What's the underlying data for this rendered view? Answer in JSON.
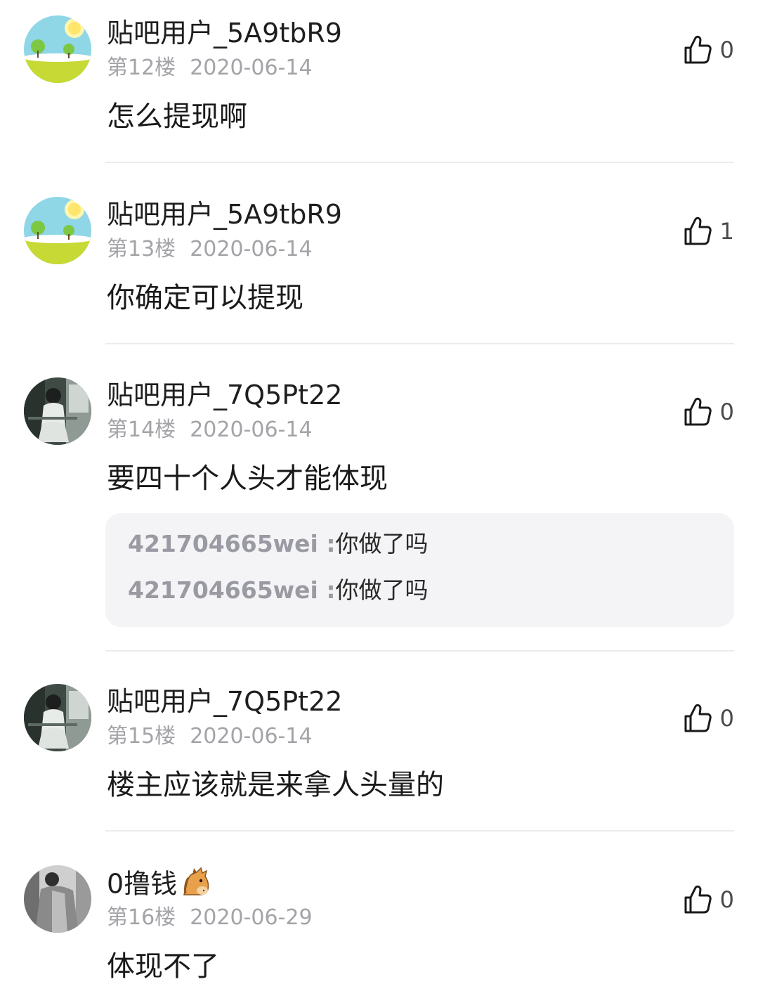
{
  "posts": [
    {
      "username": "贴吧用户_5A9tbR9",
      "floor": "第12楼",
      "date": "2020-06-14",
      "likes": "0",
      "content": "怎么提现啊",
      "avatar": "landscape-avatar"
    },
    {
      "username": "贴吧用户_5A9tbR9",
      "floor": "第13楼",
      "date": "2020-06-14",
      "likes": "1",
      "content": "你确定可以提现",
      "avatar": "landscape-avatar"
    },
    {
      "username": "贴吧用户_7Q5Pt22",
      "floor": "第14楼",
      "date": "2020-06-14",
      "likes": "0",
      "content": "要四十个人头才能体现",
      "avatar": "photo-avatar-girl",
      "replies": [
        {
          "user": "421704665wei",
          "sep": " :",
          "text": "你做了吗"
        },
        {
          "user": "421704665wei",
          "sep": " :",
          "text": "你做了吗"
        }
      ]
    },
    {
      "username": "贴吧用户_7Q5Pt22",
      "floor": "第15楼",
      "date": "2020-06-14",
      "likes": "0",
      "content": "楼主应该就是来拿人头量的",
      "avatar": "photo-avatar-girl"
    },
    {
      "username": "0撸钱",
      "username_emoji": "horse-face-icon",
      "floor": "第16楼",
      "date": "2020-06-29",
      "likes": "0",
      "content": "体现不了",
      "avatar": "photo-avatar-gray"
    }
  ],
  "colors": {
    "meta": "#a3a3a8",
    "reply_user": "#9a9aa3",
    "reply_bg": "#f4f4f6",
    "divider": "#ececef"
  }
}
